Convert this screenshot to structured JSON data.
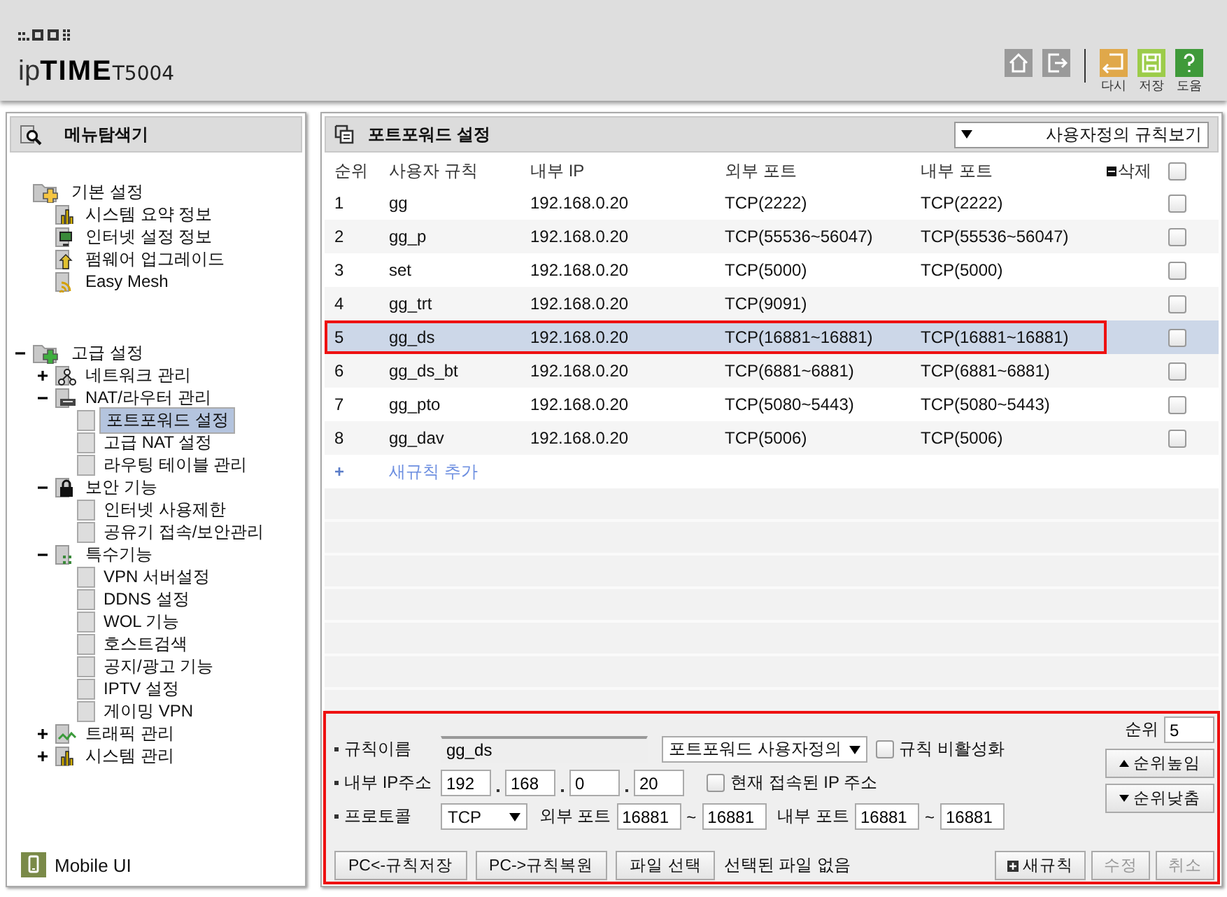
{
  "header": {
    "logo": "ip**TIME**",
    "model": "T5004",
    "toolbar": [
      {
        "kind": "home"
      },
      {
        "kind": "logout"
      },
      {
        "kind": "undo",
        "label": "다시"
      },
      {
        "kind": "save",
        "label": "저장"
      },
      {
        "kind": "help",
        "label": "도움"
      }
    ]
  },
  "sidebar": {
    "title": "메뉴탐색기",
    "tree": [
      {
        "label": "기본 설정",
        "selected": false,
        "children": [
          {
            "label": "시스템 요약 정보",
            "selected": false
          },
          {
            "label": "인터넷 설정 정보",
            "selected": false
          },
          {
            "label": "펌웨어 업그레이드",
            "selected": false
          },
          {
            "label": "Easy Mesh",
            "selected": false
          }
        ]
      },
      {
        "label": "고급 설정",
        "selected": false,
        "expanded": true,
        "children": [
          {
            "label": "네트워크 관리",
            "selected": false,
            "expanded": false
          },
          {
            "label": "NAT/라우터 관리",
            "selected": false,
            "expanded": true,
            "children": [
              {
                "label": "포트포워드 설정",
                "selected": true
              },
              {
                "label": "고급 NAT 설정",
                "selected": false
              },
              {
                "label": "라우팅 테이블 관리",
                "selected": false
              }
            ]
          },
          {
            "label": "보안 기능",
            "selected": false,
            "expanded": true,
            "children": [
              {
                "label": "인터넷 사용제한",
                "selected": false
              },
              {
                "label": "공유기 접속/보안관리",
                "selected": false
              }
            ]
          },
          {
            "label": "특수기능",
            "selected": false,
            "expanded": true,
            "children": [
              {
                "label": "VPN 서버설정",
                "selected": false
              },
              {
                "label": "DDNS 설정",
                "selected": false
              },
              {
                "label": "WOL 기능",
                "selected": false
              },
              {
                "label": "호스트검색",
                "selected": false
              },
              {
                "label": "공지/광고 기능",
                "selected": false
              },
              {
                "label": "IPTV 설정",
                "selected": false
              },
              {
                "label": "게이밍 VPN",
                "selected": false
              }
            ]
          },
          {
            "label": "트래픽 관리",
            "selected": false,
            "expanded": false
          },
          {
            "label": "시스템 관리",
            "selected": false,
            "expanded": false
          }
        ]
      }
    ],
    "mobile_link": "Mobile UI"
  },
  "main": {
    "title": "포트포워드 설정",
    "view_select": "사용자정의 규칙보기",
    "table": {
      "columns": [
        "순위",
        "사용자 규칙",
        "내부 IP",
        "외부 포트",
        "내부 포트",
        "삭제"
      ],
      "select_all_checked": false,
      "rows": [
        {
          "cells": [
            "1",
            "gg",
            "192.168.0.20",
            "TCP(2222)",
            "TCP(2222)"
          ],
          "selected": false,
          "annotated": false,
          "checked": false
        },
        {
          "cells": [
            "2",
            "gg_p",
            "192.168.0.20",
            "TCP(55536~56047)",
            "TCP(55536~56047)"
          ],
          "selected": false,
          "annotated": false,
          "checked": false
        },
        {
          "cells": [
            "3",
            "set",
            "192.168.0.20",
            "TCP(5000)",
            "TCP(5000)"
          ],
          "selected": false,
          "annotated": false,
          "checked": false
        },
        {
          "cells": [
            "4",
            "gg_trt",
            "192.168.0.20",
            "TCP(9091)",
            ""
          ],
          "selected": false,
          "annotated": false,
          "checked": false
        },
        {
          "cells": [
            "5",
            "gg_ds",
            "192.168.0.20",
            "TCP(16881~16881)",
            "TCP(16881~16881)"
          ],
          "selected": true,
          "annotated": true,
          "checked": false
        },
        {
          "cells": [
            "6",
            "gg_ds_bt",
            "192.168.0.20",
            "TCP(6881~6881)",
            "TCP(6881~6881)"
          ],
          "selected": false,
          "annotated": false,
          "checked": false
        },
        {
          "cells": [
            "7",
            "gg_pto",
            "192.168.0.20",
            "TCP(5080~5443)",
            "TCP(5080~5443)"
          ],
          "selected": false,
          "annotated": false,
          "checked": false
        },
        {
          "cells": [
            "8",
            "gg_dav",
            "192.168.0.20",
            "TCP(5006)",
            "TCP(5006)"
          ],
          "selected": false,
          "annotated": false,
          "checked": false
        }
      ],
      "add_rule": {
        "icon": "+",
        "label": "새규칙 추가"
      }
    },
    "form": {
      "annotated": true,
      "rule_name": {
        "label": "규칙이름",
        "value": "gg_ds"
      },
      "rule_type": "포트포워드 사용자정의",
      "disable_rule": {
        "label": "규칙 비활성화",
        "checked": false
      },
      "internal_ip": {
        "label": "내부 IP주소",
        "octets": [
          "192",
          "168",
          "0",
          "20"
        ]
      },
      "current_ip": {
        "label": "현재 접속된 IP 주소",
        "checked": false
      },
      "protocol": {
        "label": "프로토콜",
        "value": "TCP"
      },
      "external_port": {
        "label": "외부 포트",
        "from": "16881",
        "sep": "~",
        "to": "16881"
      },
      "internal_port": {
        "label": "내부 포트",
        "from": "16881",
        "sep": "~",
        "to": "16881"
      },
      "order": {
        "label": "순위",
        "value": "5",
        "up": "순위높임",
        "down": "순위낮춤"
      },
      "buttons": [
        "PC<-규칙저장",
        "PC->규칙복원",
        "파일 선택"
      ],
      "file_status": "선택된 파일 없음",
      "actions": [
        {
          "kind": "new",
          "label": "새규칙",
          "disabled": false
        },
        {
          "kind": "edit",
          "label": "수정",
          "disabled": true
        },
        {
          "kind": "cancel",
          "label": "취소",
          "disabled": true
        }
      ]
    }
  }
}
